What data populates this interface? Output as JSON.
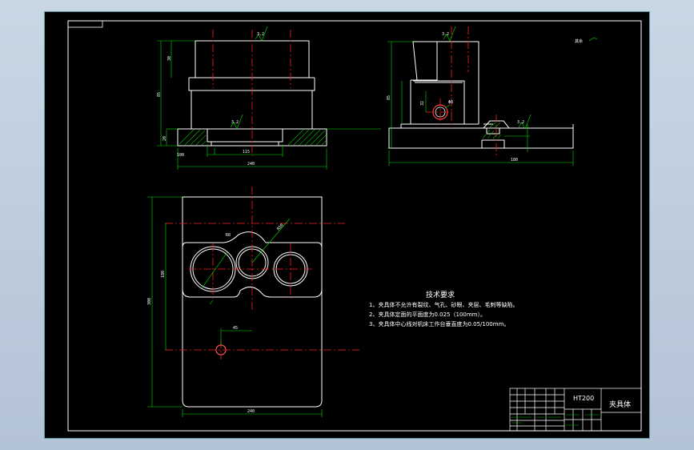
{
  "tech_requirements": {
    "title": "技术要求",
    "items": [
      "1、夹具体不允许有裂纹、气孔、砂眼、夹层、毛刺等缺陷。",
      "2、夹具体定面的平面度为0.025（100mm）。",
      "3、夹具体中心线对机床工作台垂直度为0.05/100mm。"
    ]
  },
  "title_block": {
    "material": "HT200",
    "part_name": "夹具体"
  },
  "surface_marks": {
    "front_top": "3.2",
    "front_mid": "3.2",
    "side_top": "3.2",
    "side_bottom": "3.2",
    "corner": "其余"
  },
  "dimensions": {
    "front_width": "240",
    "front_height": "85",
    "front_top_h": "30",
    "front_base_h": "20",
    "front_slot": "115",
    "front_slot_inner": "100",
    "side_width": "180",
    "side_height": "85",
    "side_hole": "Φ8",
    "side_small": "32",
    "plan_height": "300",
    "plan_inner": "180",
    "plan_width": "240",
    "plan_hole_offset": "45",
    "plan_arc": "R50",
    "plan_small_r": "R8"
  },
  "colors": {
    "line": "#ffffff",
    "center": "#ff2020",
    "dim": "#00e000",
    "hatch": "#00c000",
    "frame": "#5fa0a8"
  }
}
